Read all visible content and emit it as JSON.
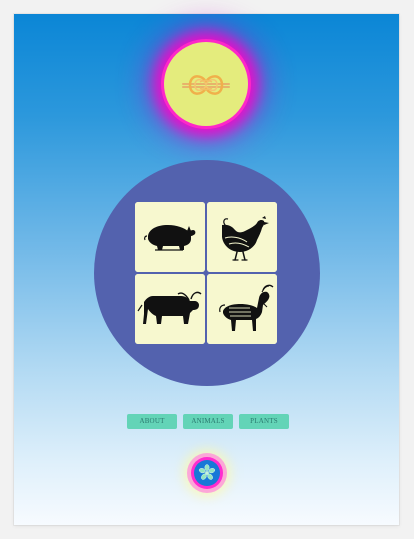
{
  "header": {
    "logo_icon": "knot-emblem-icon"
  },
  "gallery": {
    "tiles": [
      {
        "icon": "pig-icon"
      },
      {
        "icon": "chicken-icon"
      },
      {
        "icon": "bull-icon"
      },
      {
        "icon": "goat-icon"
      }
    ]
  },
  "nav": {
    "items": [
      {
        "label": "ABOUT"
      },
      {
        "label": "ANIMALS"
      },
      {
        "label": "PLANTS"
      }
    ]
  },
  "footer": {
    "icon": "flower-icon"
  },
  "colors": {
    "page_gradient_top": "#0b86d6",
    "page_gradient_bottom": "#f7fbff",
    "logo_fill": "#e4ec7d",
    "logo_glow": "#ff1fc6",
    "circle": "#5362ae",
    "tile": "#f7f8cf",
    "button": "#63d4b7",
    "button_text": "#2b7a6f",
    "flower_fill": "#1778d7"
  }
}
